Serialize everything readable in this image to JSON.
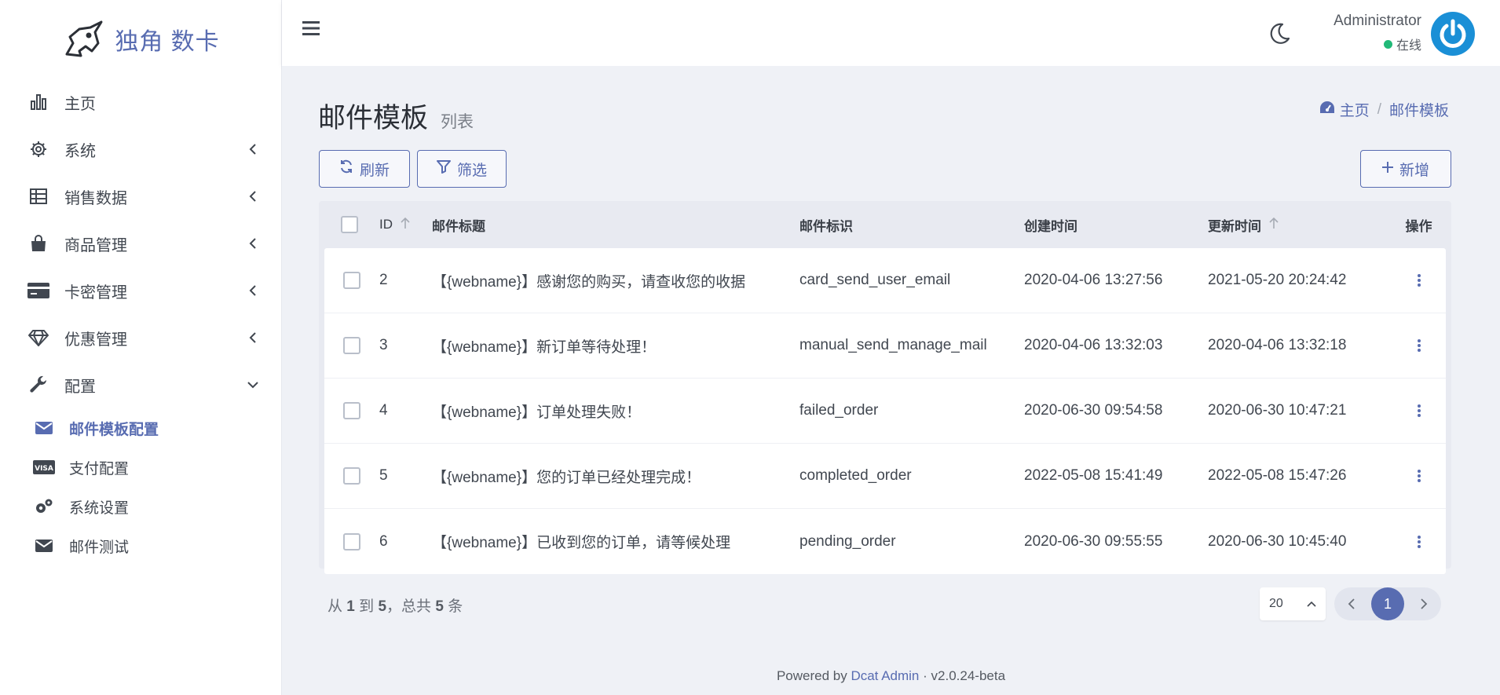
{
  "brand": {
    "name": "独角 数卡"
  },
  "sidebar": {
    "items": [
      {
        "label": "主页",
        "icon": "bar-chart-icon",
        "has_arrow": false
      },
      {
        "label": "系统",
        "icon": "gear-icon",
        "has_arrow": true
      },
      {
        "label": "销售数据",
        "icon": "table-icon",
        "has_arrow": true
      },
      {
        "label": "商品管理",
        "icon": "shopping-bag-icon",
        "has_arrow": true
      },
      {
        "label": "卡密管理",
        "icon": "credit-card-icon",
        "has_arrow": true
      },
      {
        "label": "优惠管理",
        "icon": "diamond-icon",
        "has_arrow": true
      },
      {
        "label": "配置",
        "icon": "wrench-icon",
        "has_arrow": true,
        "expanded": true
      }
    ],
    "subitems": [
      {
        "label": "邮件模板配置",
        "icon": "envelope-icon",
        "active": true
      },
      {
        "label": "支付配置",
        "icon": "visa-icon",
        "active": false
      },
      {
        "label": "系统设置",
        "icon": "gears-icon",
        "active": false
      },
      {
        "label": "邮件测试",
        "icon": "envelope-icon",
        "active": false
      }
    ]
  },
  "topbar": {
    "user_name": "Administrator",
    "user_status": "在线"
  },
  "page": {
    "title": "邮件模板",
    "subtitle": "列表",
    "breadcrumb": {
      "home": "主页",
      "current": "邮件模板"
    }
  },
  "toolbar": {
    "refresh_label": "刷新",
    "filter_label": "筛选",
    "new_label": "新增"
  },
  "table": {
    "columns": [
      "ID",
      "邮件标题",
      "邮件标识",
      "创建时间",
      "更新时间",
      "操作"
    ],
    "rows": [
      {
        "id": "2",
        "title": "【{webname}】感谢您的购买，请查收您的收据",
        "key": "card_send_user_email",
        "created": "2020-04-06 13:27:56",
        "updated": "2021-05-20 20:24:42"
      },
      {
        "id": "3",
        "title": "【{webname}】新订单等待处理！",
        "key": "manual_send_manage_mail",
        "created": "2020-04-06 13:32:03",
        "updated": "2020-04-06 13:32:18"
      },
      {
        "id": "4",
        "title": "【{webname}】订单处理失败！",
        "key": "failed_order",
        "created": "2020-06-30 09:54:58",
        "updated": "2020-06-30 10:47:21"
      },
      {
        "id": "5",
        "title": "【{webname}】您的订单已经处理完成！",
        "key": "completed_order",
        "created": "2022-05-08 15:41:49",
        "updated": "2022-05-08 15:47:26"
      },
      {
        "id": "6",
        "title": "【{webname}】已收到您的订单，请等候处理",
        "key": "pending_order",
        "created": "2020-06-30 09:55:55",
        "updated": "2020-06-30 10:45:40"
      }
    ]
  },
  "pagination": {
    "summary_prefix": "从",
    "from": "1",
    "to_word": "到",
    "to": "5",
    "total_word": "，总共",
    "total": "5",
    "unit": "条",
    "per_page": "20",
    "current_page": "1"
  },
  "footer": {
    "powered_by": "Powered by",
    "link": "Dcat Admin",
    "sep": "·",
    "version": "v2.0.24-beta"
  },
  "colors": {
    "accent": "#586cb1",
    "online": "#21b978",
    "avatar": "#1a8fd6"
  }
}
